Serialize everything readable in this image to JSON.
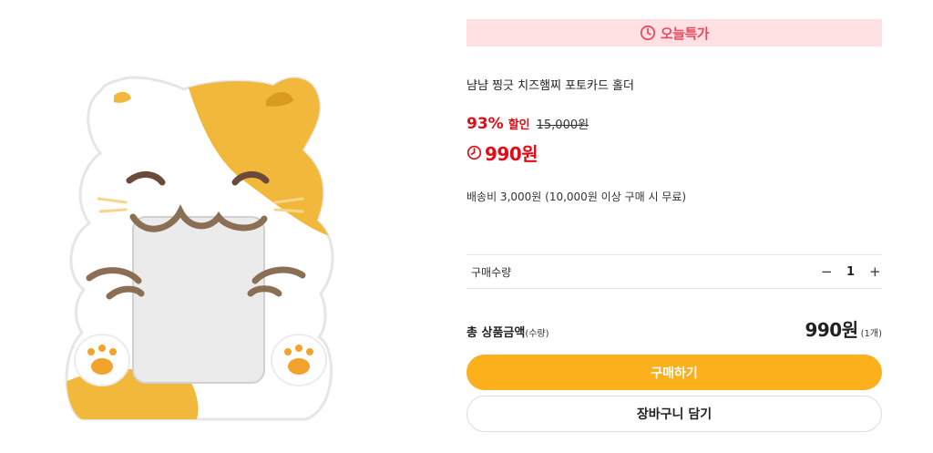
{
  "deal_banner": {
    "label": "오늘특가",
    "icon": "clock-icon",
    "color": "#e84a5f",
    "background": "#ffe1e4"
  },
  "product": {
    "title": "냠냠 찡긋 치즈햄찌 포토카드 홀더",
    "image_alt": "calico-cat-photocard-holder"
  },
  "price": {
    "discount_rate": "93%",
    "discount_label": "할인",
    "original_price": "15,000원",
    "sale_price": "990원",
    "sale_icon": "clock-icon",
    "accent_color": "#e30b17"
  },
  "shipping": {
    "text": "배송비 3,000원 (10,000원 이상 구매 시 무료)"
  },
  "quantity": {
    "label": "구매수량",
    "minus": "−",
    "value": "1",
    "plus": "+"
  },
  "total": {
    "label": "총 상품금액",
    "sub_label": "(수량)",
    "amount": "990원",
    "count": "(1개)"
  },
  "actions": {
    "buy_label": "구매하기",
    "cart_label": "장바구니 담기",
    "buy_color": "#fbb01c"
  }
}
